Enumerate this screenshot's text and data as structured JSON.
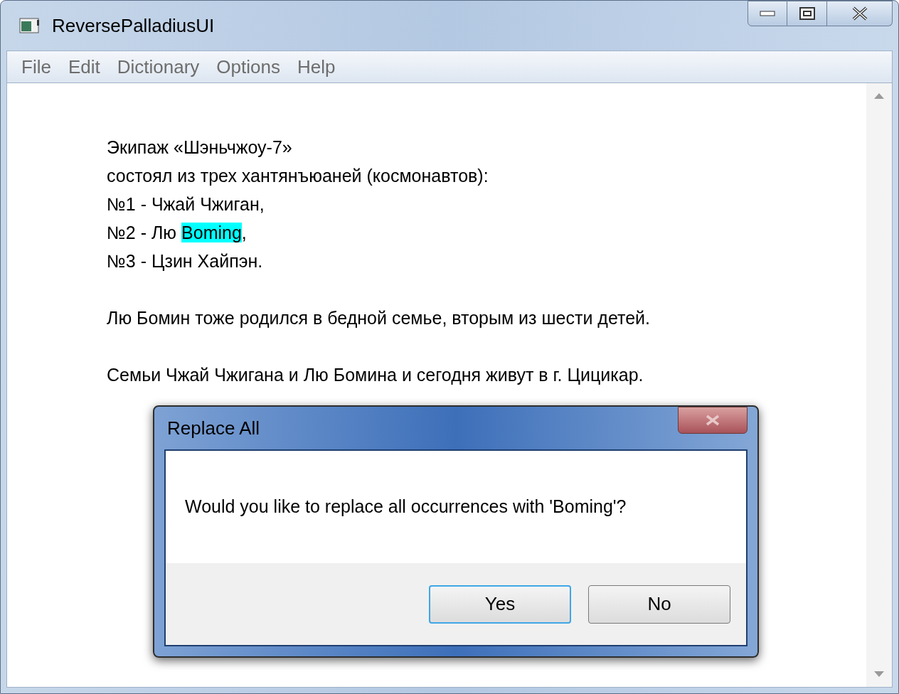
{
  "window": {
    "title": "ReversePalladiusUI"
  },
  "menu": [
    {
      "label": "File"
    },
    {
      "label": "Edit"
    },
    {
      "label": "Dictionary"
    },
    {
      "label": "Options"
    },
    {
      "label": "Help"
    }
  ],
  "document": {
    "paragraphs": [
      {
        "lines": [
          {
            "segments": [
              {
                "text": "Экипаж «Шэньчжоу-7»",
                "highlighted": false
              }
            ]
          },
          {
            "segments": [
              {
                "text": "состоял из трех хантянъюаней (космонавтов):",
                "highlighted": false
              }
            ]
          },
          {
            "segments": [
              {
                "text": "№1 - Чжай Чжиган,",
                "highlighted": false
              }
            ]
          },
          {
            "segments": [
              {
                "text": "№2 - Лю ",
                "highlighted": false
              },
              {
                "text": "Boming",
                "highlighted": true
              },
              {
                "text": ",",
                "highlighted": false
              }
            ]
          },
          {
            "segments": [
              {
                "text": "№3 - Цзин Хайпэн.",
                "highlighted": false
              }
            ]
          }
        ]
      },
      {
        "lines": [
          {
            "segments": [
              {
                "text": "Лю Бомин тоже родился в бедной семье, вторым из шести детей.",
                "highlighted": false
              }
            ]
          }
        ]
      },
      {
        "lines": [
          {
            "segments": [
              {
                "text": "Семьи Чжай Чжигана и Лю Бомина и сегодня живут в г. Цицикар.",
                "highlighted": false
              }
            ]
          }
        ]
      }
    ]
  },
  "dialog": {
    "title": "Replace All",
    "message": "Would you like to replace all occurrences with 'Boming'?",
    "buttons": [
      {
        "label": "Yes",
        "default": true
      },
      {
        "label": "No",
        "default": false
      }
    ]
  }
}
